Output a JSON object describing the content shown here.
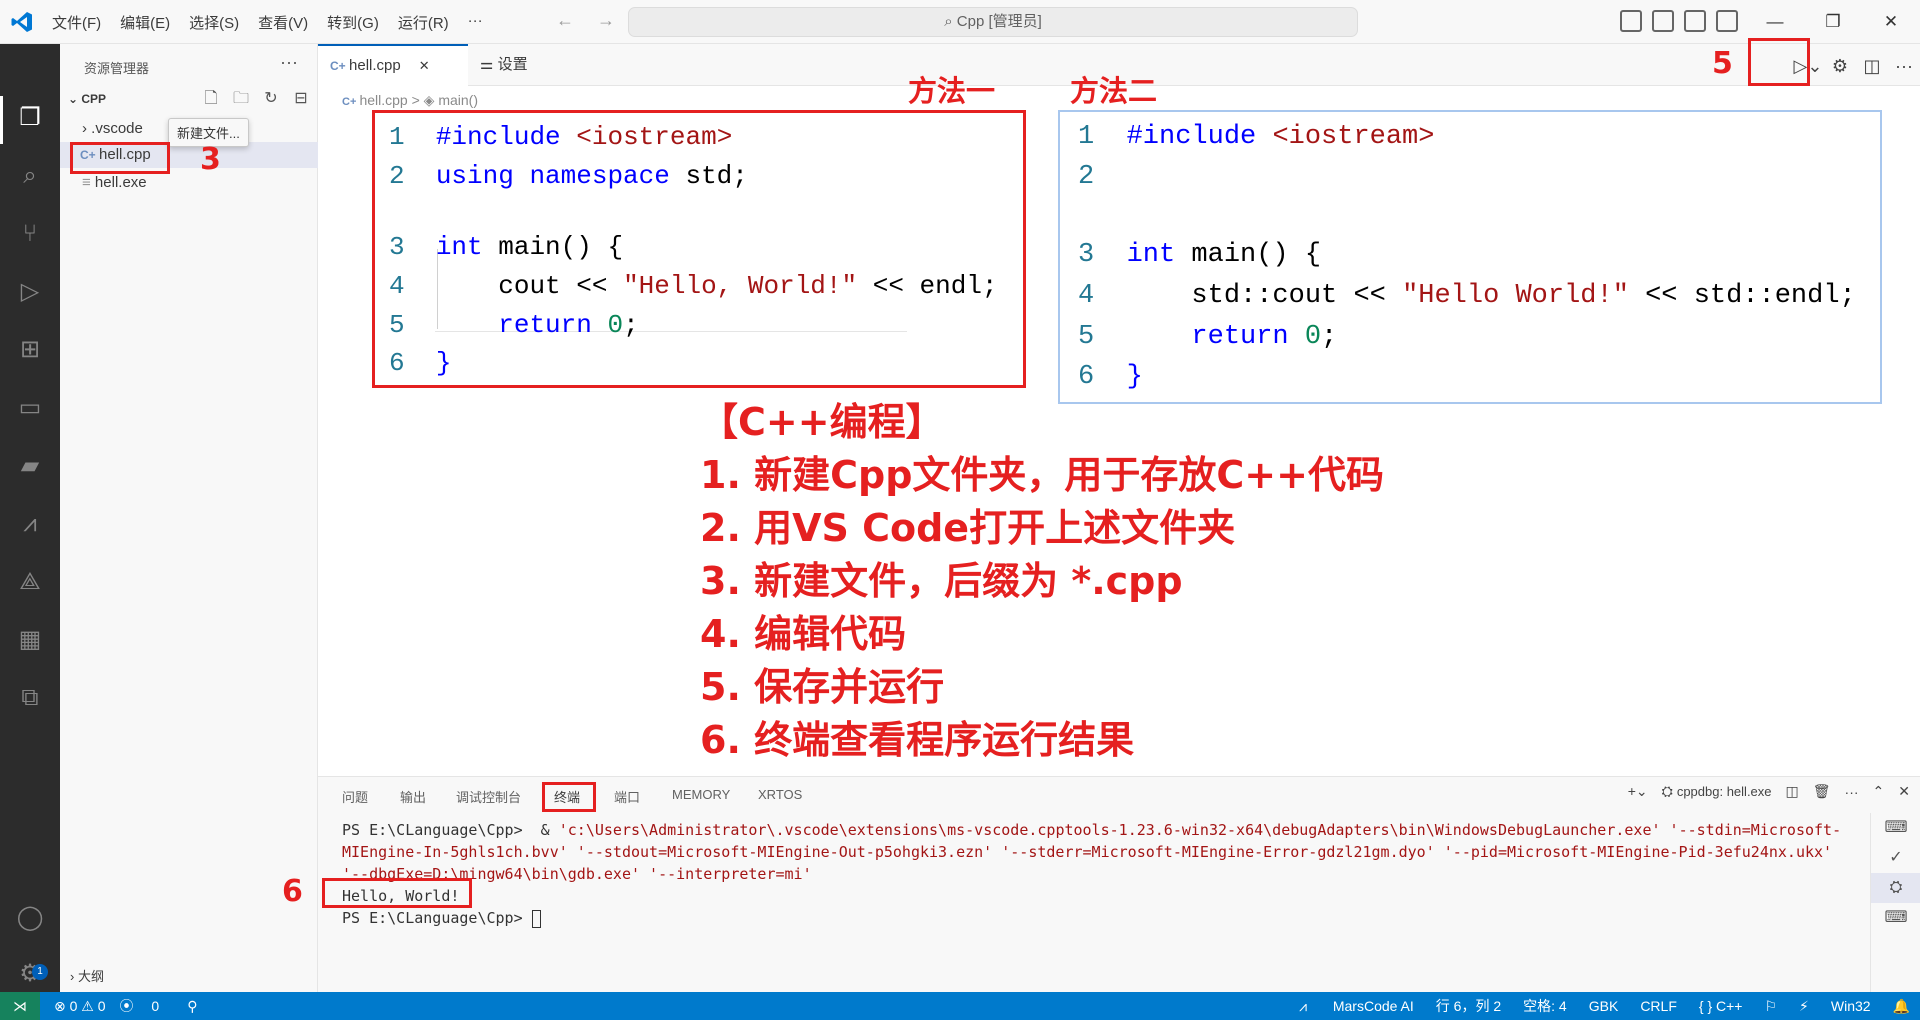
{
  "titlebar": {
    "menus": [
      "文件(F)",
      "编辑(E)",
      "选择(S)",
      "查看(V)",
      "转到(G)",
      "运行(R)",
      "···"
    ],
    "search": "Cpp [管理员]",
    "nav_back": "←",
    "nav_forward": "→",
    "minimize": "—",
    "maximize": "❐",
    "close": "✕"
  },
  "sidebar": {
    "title": "资源管理器",
    "more": "···",
    "folder": "CPP",
    "items": [
      ".vscode",
      "hell.cpp",
      "hell.exe"
    ],
    "tooltip": "新建文件...",
    "outline": "大纲"
  },
  "tabs": [
    {
      "label": "hell.cpp",
      "close": "✕"
    },
    {
      "label": "设置"
    }
  ],
  "breadcrumb": {
    "file": "hell.cpp",
    "sep": ">",
    "symbol": "main()"
  },
  "annotations": {
    "method1": "方法一",
    "method2": "方法二",
    "n3": "3",
    "n5": "5",
    "n6": "6"
  },
  "code1": {
    "lines": [
      {
        "n": "1",
        "text": "#include <iostream>"
      },
      {
        "n": "2",
        "text": "using namespace std;"
      },
      {
        "n": "3",
        "text": "int main() {"
      },
      {
        "n": "4",
        "text": "    cout << \"Hello, World!\" << endl;"
      },
      {
        "n": "5",
        "text": "    return 0;"
      },
      {
        "n": "6",
        "text": "}"
      }
    ]
  },
  "code2": {
    "lines": [
      {
        "n": "1",
        "text": "#include <iostream>"
      },
      {
        "n": "2",
        "text": ""
      },
      {
        "n": "3",
        "text": "int main() {"
      },
      {
        "n": "4",
        "text": "    std::cout << \"Hello World!\" << std::endl;"
      },
      {
        "n": "5",
        "text": "    return 0;"
      },
      {
        "n": "6",
        "text": "}"
      }
    ]
  },
  "steps": {
    "title": "【C++编程】",
    "s1": "1. 新建Cpp文件夹，用于存放C++代码",
    "s2": "2. 用VS Code打开上述文件夹",
    "s3": "3. 新建文件，后缀为 *.cpp",
    "s4": "4. 编辑代码",
    "s5": "5. 保存并运行",
    "s6": "6. 终端查看程序运行结果"
  },
  "panel": {
    "tabs": [
      "问题",
      "输出",
      "调试控制台",
      "终端",
      "端口",
      "MEMORY",
      "XRTOS"
    ],
    "active_tab": "终端",
    "session": "cppdbg: hell.exe",
    "terminal": {
      "l1_prompt": "PS E:\\CLanguage\\Cpp>  & ",
      "l1_path": "'c:\\Users\\Administrator\\.vscode\\extensions\\ms-vscode.cpptools-1.23.6-win32-x64\\debugAdapters\\bin\\WindowsDebugLauncher.exe' '--stdin=Microsoft-",
      "l2": "MIEngine-In-5ghls1ch.bvv' '--stdout=Microsoft-MIEngine-Out-p5ohgki3.ezn' '--stderr=Microsoft-MIEngine-Error-gdzl21gm.dyo' '--pid=Microsoft-MIEngine-Pid-3efu24nx.ukx'",
      "l3": "'--dbgExe=D:\\mingw64\\bin\\gdb.exe' '--interpreter=mi'",
      "l4": "Hello, World!",
      "l5": "PS E:\\CLanguage\\Cpp> "
    }
  },
  "statusbar": {
    "errors": "⊗ 0 ⚠ 0",
    "ports": "0",
    "marscode": "MarsCode AI",
    "position": "行 6，列 2",
    "spaces": "空格: 4",
    "encoding": "GBK",
    "eol": "CRLF",
    "lang": "{ } C++",
    "platform": "Win32",
    "badge": "1"
  },
  "colors": {
    "accent": "#005fb8",
    "annotation": "#e52020",
    "statusbar": "#007acc"
  }
}
